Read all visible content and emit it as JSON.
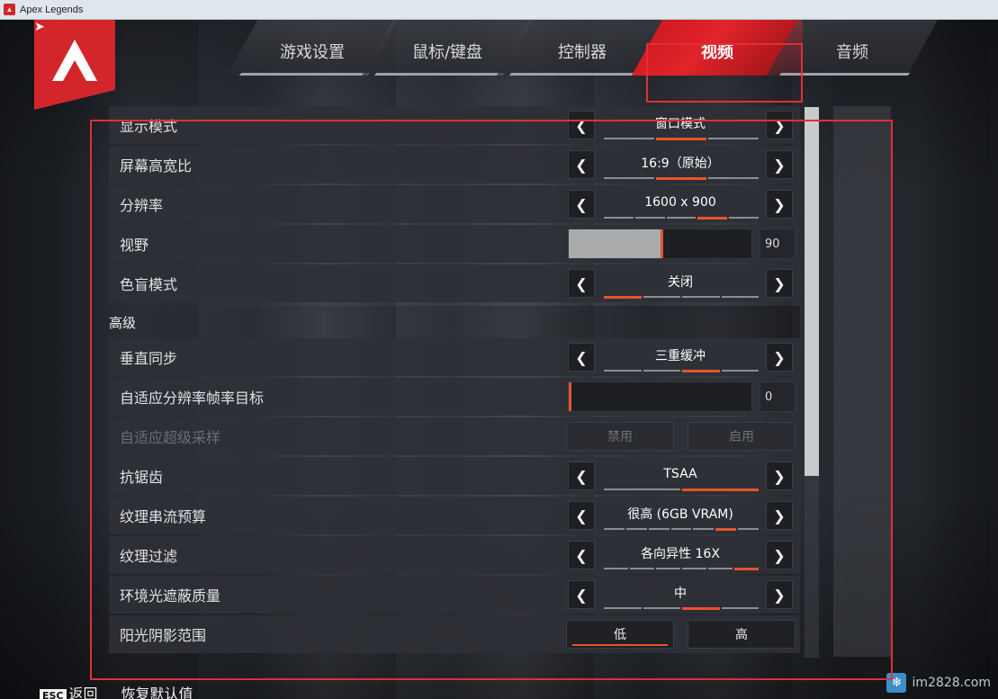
{
  "window": {
    "title": "Apex Legends"
  },
  "tabs": [
    {
      "label": "游戏设置",
      "active": false
    },
    {
      "label": "鼠标/键盘",
      "active": false
    },
    {
      "label": "控制器",
      "active": false
    },
    {
      "label": "视频",
      "active": true
    },
    {
      "label": "音频",
      "active": false
    }
  ],
  "settings": {
    "display_mode": {
      "label": "显示模式",
      "value": "窗口模式",
      "options_count": 3,
      "selected_index": 1
    },
    "aspect_ratio": {
      "label": "屏幕高宽比",
      "value": "16:9（原始）",
      "options_count": 3,
      "selected_index": 1
    },
    "resolution": {
      "label": "分辨率",
      "value": "1600 x 900",
      "options_count": 5,
      "selected_index": 3
    },
    "fov": {
      "label": "视野",
      "value": "90",
      "fill_fraction": 0.5
    },
    "colorblind": {
      "label": "色盲模式",
      "value": "关闭",
      "options_count": 4,
      "selected_index": 0
    },
    "advanced_heading": "高级",
    "vsync": {
      "label": "垂直同步",
      "value": "三重缓冲",
      "options_count": 4,
      "selected_index": 2
    },
    "adaptive_res": {
      "label": "自适应分辨率帧率目标",
      "value": "0",
      "fill_fraction": 0.0
    },
    "adaptive_ss": {
      "label": "自适应超级采样",
      "off_label": "禁用",
      "on_label": "启用"
    },
    "antialiasing": {
      "label": "抗锯齿",
      "value": "TSAA",
      "options_count": 2,
      "selected_index": 1
    },
    "texture_budget": {
      "label": "纹理串流预算",
      "value": "很高 (6GB VRAM)",
      "options_count": 7,
      "selected_index": 5
    },
    "texture_filter": {
      "label": "纹理过滤",
      "value": "各向异性 16X",
      "options_count": 6,
      "selected_index": 5
    },
    "ambient_occlusion": {
      "label": "环境光遮蔽质量",
      "value": "中",
      "options_count": 4,
      "selected_index": 2
    },
    "sun_shadow": {
      "label": "阳光阴影范围",
      "low_label": "低",
      "high_label": "高"
    }
  },
  "footer": {
    "esc_key": "ESC",
    "back_label": "返回",
    "restore_label": "恢复默认值"
  },
  "watermark": {
    "text": "im2828.com"
  },
  "colors": {
    "accent": "#e8532d",
    "active_tab": "#d3262b",
    "highlight_box": "#e03035"
  }
}
